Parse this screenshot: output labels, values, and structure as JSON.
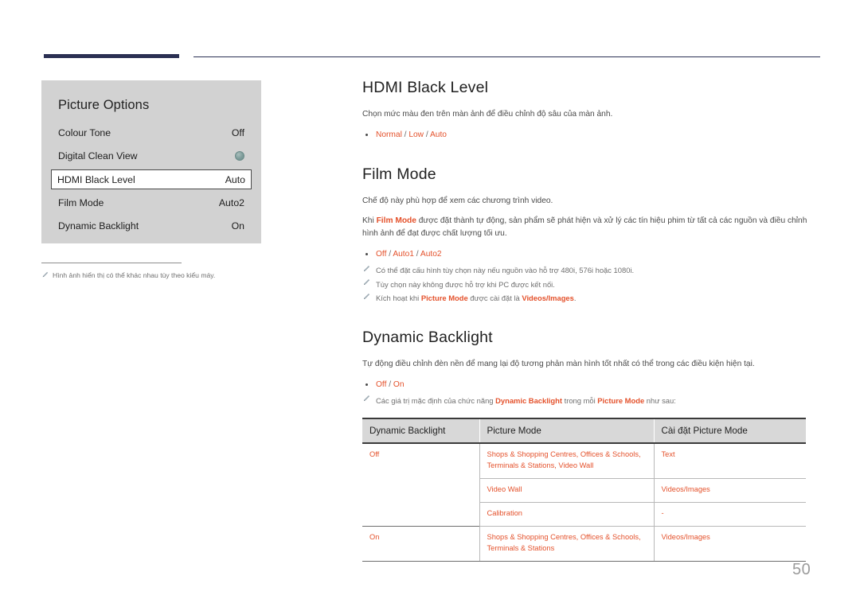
{
  "header": {
    "rule_color": "#2b3053"
  },
  "accent_color": "#e4512b",
  "osd": {
    "title": "Picture Options",
    "rows": [
      {
        "label": "Colour Tone",
        "value": "Off",
        "type": "text",
        "selected": false
      },
      {
        "label": "Digital Clean View",
        "value": "",
        "type": "dot",
        "selected": false
      },
      {
        "label": "HDMI Black Level",
        "value": "Auto",
        "type": "text",
        "selected": true
      },
      {
        "label": "Film Mode",
        "value": "Auto2",
        "type": "text",
        "selected": false
      },
      {
        "label": "Dynamic Backlight",
        "value": "On",
        "type": "text",
        "selected": false
      }
    ],
    "note": "Hình ảnh hiển thị có thể khác nhau tùy theo kiểu máy."
  },
  "sections": [
    {
      "heading": "HDMI Black Level",
      "paragraph": "Chọn mức màu đen trên màn ảnh để điều chỉnh độ sâu của màn ảnh.",
      "options": "Normal / Low / Auto"
    },
    {
      "heading": "Film Mode",
      "paragraph1": "Chế độ này phù hợp để xem các chương trình video.",
      "paragraph2_pre": "Khi ",
      "paragraph2_accent": "Film Mode",
      "paragraph2_post": " được đặt thành tự động, sản phẩm sẽ phát hiện và xử lý các tín hiệu phim từ tất cả các nguồn và điều chỉnh hình ảnh để đạt được chất lượng tối ưu.",
      "options": "Off / Auto1 / Auto2",
      "notes": [
        {
          "text": "Có thể đặt cấu hình tùy chọn này nếu nguồn vào hỗ trợ 480i, 576i hoặc 1080i."
        },
        {
          "text": "Tùy chọn này không được hỗ trợ khi PC được kết nối."
        },
        {
          "pre": "Kích hoạt khi ",
          "accent1": "Picture Mode",
          "mid": " được cài đặt là ",
          "accent2": "Videos/Images",
          "post": "."
        }
      ]
    },
    {
      "heading": "Dynamic Backlight",
      "paragraph": "Tự động điều chỉnh đèn nền để mang lại độ tương phản màn hình tốt nhất có thể trong các điều kiện hiện tại.",
      "options": "Off / On",
      "table_note": {
        "pre": "Các giá trị mặc định của chức năng ",
        "accent1": "Dynamic Backlight",
        "mid": " trong mỗi ",
        "accent2": "Picture Mode",
        "post": " như sau:"
      }
    }
  ],
  "table": {
    "headers": [
      "Dynamic Backlight",
      "Picture Mode",
      "Cài đặt Picture Mode"
    ],
    "rows": [
      {
        "backlight": "Off",
        "picture_mode": "Shops & Shopping Centres, Offices & Schools, Terminals & Stations, Video Wall",
        "setting": "Text"
      },
      {
        "backlight": "",
        "picture_mode": "Video Wall",
        "setting": "Videos/Images"
      },
      {
        "backlight": "",
        "picture_mode": "Calibration",
        "setting": "-"
      },
      {
        "backlight": "On",
        "picture_mode": "Shops & Shopping Centres, Offices & Schools, Terminals & Stations",
        "setting": "Videos/Images"
      }
    ]
  },
  "page_number": "50"
}
